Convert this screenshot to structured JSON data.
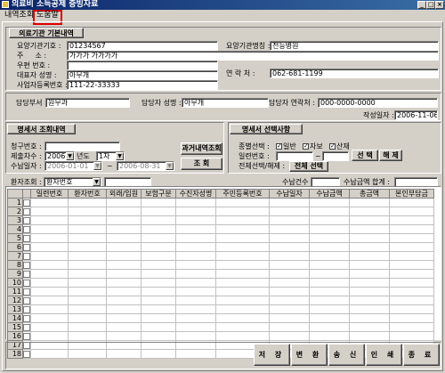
{
  "window": {
    "title": "의료비 소득공제 증빙자료"
  },
  "menu": {
    "items": [
      "내역조회",
      "도움말"
    ]
  },
  "provider": {
    "section_title": "의료기관 기본내역",
    "code_label": "요양기관기호 :",
    "code_value": "01234567",
    "name_label": "요양기관명칭 :",
    "name_value": "전능병원",
    "addr_label": "주 　 소 :",
    "addr_value": "가가가 가가가가",
    "zip_label": "우편 번호 :",
    "zip_value": "",
    "rep_label": "대표자 성명 :",
    "rep_value": "아무개",
    "phone_label": "연 락 처 :",
    "phone_value": "062-681-1199",
    "biz_label": "사업자등록번호 :",
    "biz_value": "111-22-33333"
  },
  "manager": {
    "dept_label": "담당부서 :",
    "dept_value": "원무과",
    "name_label": "담당자 성명 :",
    "name_value": "아무개",
    "phone_label": "담당자 연락처 :",
    "phone_value": "000-0000-0000",
    "date_label": "작성일자 :",
    "date_value": "2006-11-06"
  },
  "query": {
    "section_title": "명세서 조회내역",
    "claim_no_label": "청구번호 :",
    "claim_no_value": "",
    "submit_label": "제출차수 :",
    "year_value": "2006",
    "year_suffix": "년도",
    "round_value": "1차",
    "period_label": "수납일자 :",
    "date_from": "2006-01-01",
    "tilde": "~",
    "date_to": "2006-08-31",
    "history_button": "과거내역조회",
    "search_button": "조 회"
  },
  "select": {
    "section_title": "명세서 선택사항",
    "type_label": "종별선택 :",
    "opt_general": "일반",
    "opt_auto": "자보",
    "opt_industrial": "산재",
    "serial_label": "일련번호 :",
    "serial_from": "",
    "serial_tilde": "~",
    "serial_to": "",
    "select_button": "선 택",
    "clear_button": "해 제",
    "all_label": "전체선택/해제 :",
    "all_button": "전체 선택"
  },
  "patient": {
    "label": "환자조회 :",
    "mode_value": "환자번호",
    "search_value": "",
    "count_label": "수납건수 :",
    "count_value": "",
    "total_label": "수납금액 합계 :",
    "total_value": ""
  },
  "table": {
    "columns": [
      "일련번호",
      "환자번호",
      "외래/입원",
      "보험구분",
      "수진자성명",
      "주민등록번호",
      "수납일자",
      "수납금액",
      "총금액",
      "본인부담금"
    ],
    "row_numbers": [
      "1",
      "2",
      "3",
      "4",
      "5",
      "6",
      "7",
      "8",
      "9",
      "10",
      "11",
      "12",
      "13",
      "14",
      "15",
      "16",
      "17",
      "18"
    ]
  },
  "footer": {
    "buttons": [
      "저 장",
      "변 환",
      "송 신",
      "인 쇄",
      "종 료"
    ]
  }
}
